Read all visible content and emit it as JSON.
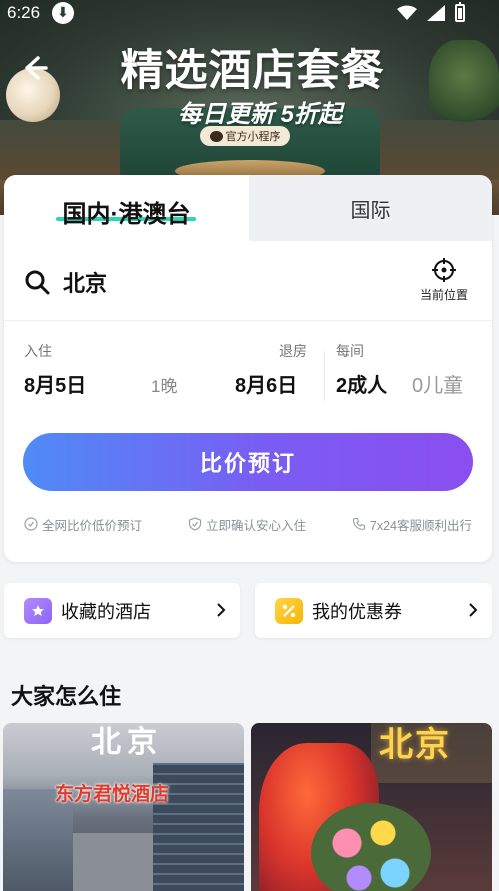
{
  "status_bar": {
    "time": "6:26",
    "download_glyph": "⬇"
  },
  "banner": {
    "title": "精选酒店套餐",
    "subtitle": "每日更新 5折起",
    "pill": "官方小程序"
  },
  "tabs": {
    "domestic": "国内·港澳台",
    "international": "国际"
  },
  "search": {
    "city": "北京",
    "locate_label": "当前位置"
  },
  "dates": {
    "checkin_label": "入住",
    "checkin": "8月5日",
    "nights": "1晚",
    "checkout_label": "退房",
    "checkout": "8月6日",
    "per_room_label": "每间",
    "adults": "2成人",
    "children": "0儿童"
  },
  "book_button": "比价预订",
  "perks": [
    "全网比价低价预订",
    "立即确认安心入住",
    "7x24客服顺利出行"
  ],
  "shortcuts": {
    "favorites": "收藏的酒店",
    "coupons": "我的优惠券"
  },
  "section_title": "大家怎么住",
  "photos": [
    {
      "city": "北京",
      "name": "东方君悦酒店"
    },
    {
      "city": "北京"
    }
  ],
  "icons": {
    "back": "back-arrow-icon",
    "search": "search-icon",
    "locate": "crosshair-icon",
    "favorites": "star-folder-icon",
    "coupons": "coupon-icon",
    "chevron": "chevron-right-icon"
  },
  "colors": {
    "accent_underline": "#2fd3b7",
    "button_gradient_start": "#4f8bf6",
    "button_gradient_end": "#8b4ef0",
    "favorites_icon": "#9d73f8",
    "coupons_icon": "#f7b500"
  }
}
